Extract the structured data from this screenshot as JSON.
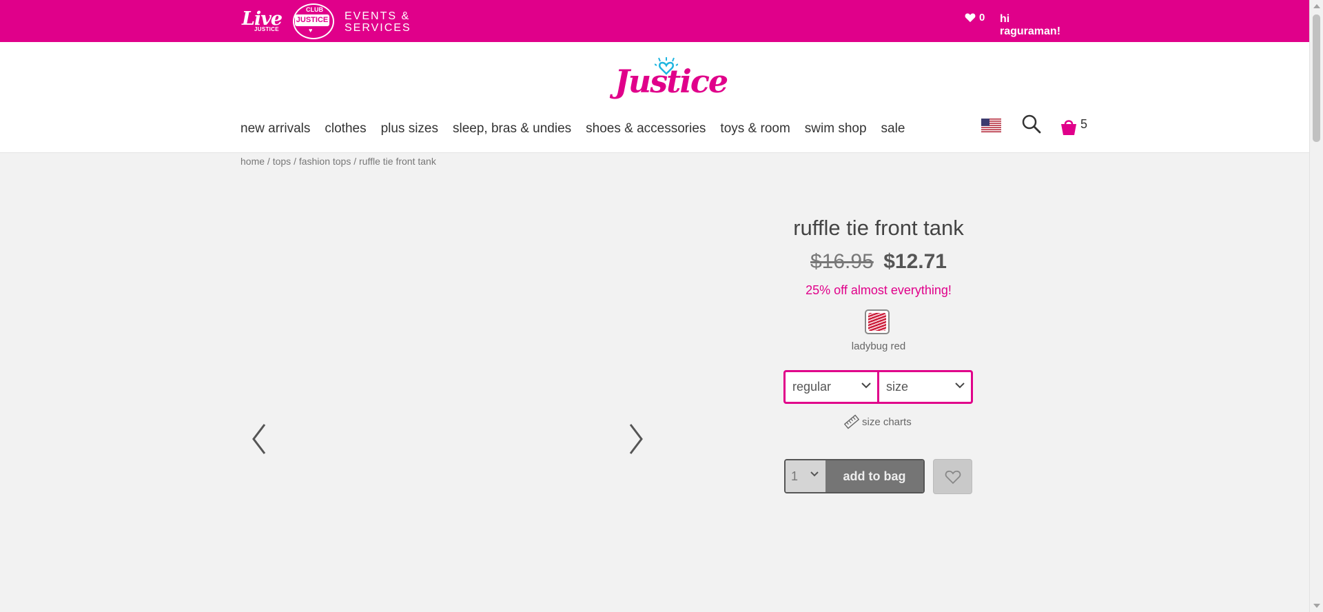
{
  "topbar": {
    "live_logo": {
      "line1": "Live",
      "line2": "JUSTICE"
    },
    "club_logo": {
      "top": "CLUB",
      "middle": "JUSTICE",
      "bottom": "♥"
    },
    "events_line1": "EVENTS &",
    "events_line2": "SERVICES",
    "wishlist_count": "0",
    "greeting": "hi raguraman!"
  },
  "header": {
    "brand_logo_text": "Justice",
    "nav": [
      "new arrivals",
      "clothes",
      "plus sizes",
      "sleep, bras & undies",
      "shoes & accessories",
      "toys & room",
      "swim shop",
      "sale"
    ],
    "bag_count": "5"
  },
  "breadcrumb": [
    "home",
    "tops",
    "fashion tops",
    "ruffle tie front tank"
  ],
  "product": {
    "title": "ruffle tie front tank",
    "old_price": "$16.95",
    "new_price": "$12.71",
    "promo": "25% off almost everything!",
    "color_name": "ladybug red",
    "fit_select": "regular",
    "size_select": "size",
    "size_charts": "size charts",
    "quantity": "1",
    "add_to_bag": "add to bag"
  },
  "colors": {
    "brand_pink": "#e0008a",
    "swatch_red": "#c8102e",
    "button_gray": "#757575"
  },
  "icons": {
    "wishlist": "heart-icon",
    "search": "search-icon",
    "bag": "shopping-bag-icon",
    "flag": "us-flag-icon",
    "ruler": "ruler-icon",
    "prev": "chevron-left-icon",
    "next": "chevron-right-icon"
  }
}
